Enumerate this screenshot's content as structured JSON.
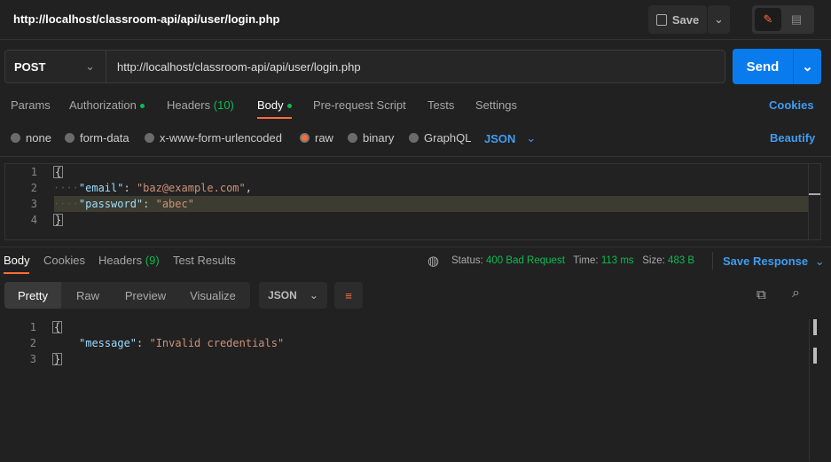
{
  "header": {
    "title": "http://localhost/classroom-api/api/user/login.php",
    "save_label": "Save"
  },
  "request": {
    "method": "POST",
    "url": "http://localhost/classroom-api/api/user/login.php",
    "send_label": "Send"
  },
  "tabs": [
    {
      "label": "Params"
    },
    {
      "label": "Authorization"
    },
    {
      "label": "Headers",
      "count": "(10)"
    },
    {
      "label": "Body"
    },
    {
      "label": "Pre-request Script"
    },
    {
      "label": "Tests"
    },
    {
      "label": "Settings"
    }
  ],
  "cookies_label": "Cookies",
  "body_types": [
    "none",
    "form-data",
    "x-www-form-urlencoded",
    "raw",
    "binary",
    "GraphQL"
  ],
  "body_format": "JSON",
  "beautify_label": "Beautify",
  "request_body": {
    "lines": [
      "1",
      "2",
      "3",
      "4"
    ],
    "open": "{",
    "close": "}",
    "email_key": "\"email\"",
    "email_val": "\"baz@example.com\"",
    "password_key": "\"password\"",
    "password_val": "\"abec\""
  },
  "response": {
    "tabs": [
      {
        "label": "Body"
      },
      {
        "label": "Cookies"
      },
      {
        "label": "Headers",
        "count": "(9)"
      },
      {
        "label": "Test Results"
      }
    ],
    "status_label": "Status:",
    "status": "400 Bad Request",
    "time_label": "Time:",
    "time": "113 ms",
    "size_label": "Size:",
    "size": "483 B",
    "save_response": "Save Response",
    "views": [
      "Pretty",
      "Raw",
      "Preview",
      "Visualize"
    ],
    "format": "JSON",
    "lines": [
      "1",
      "2",
      "3"
    ],
    "message_key": "\"message\"",
    "message_val": "\"Invalid credentials\""
  },
  "colors": {
    "accent": "#ff6c37",
    "send": "#097bed",
    "link": "#3f9cf0",
    "success": "#0cbb52"
  }
}
